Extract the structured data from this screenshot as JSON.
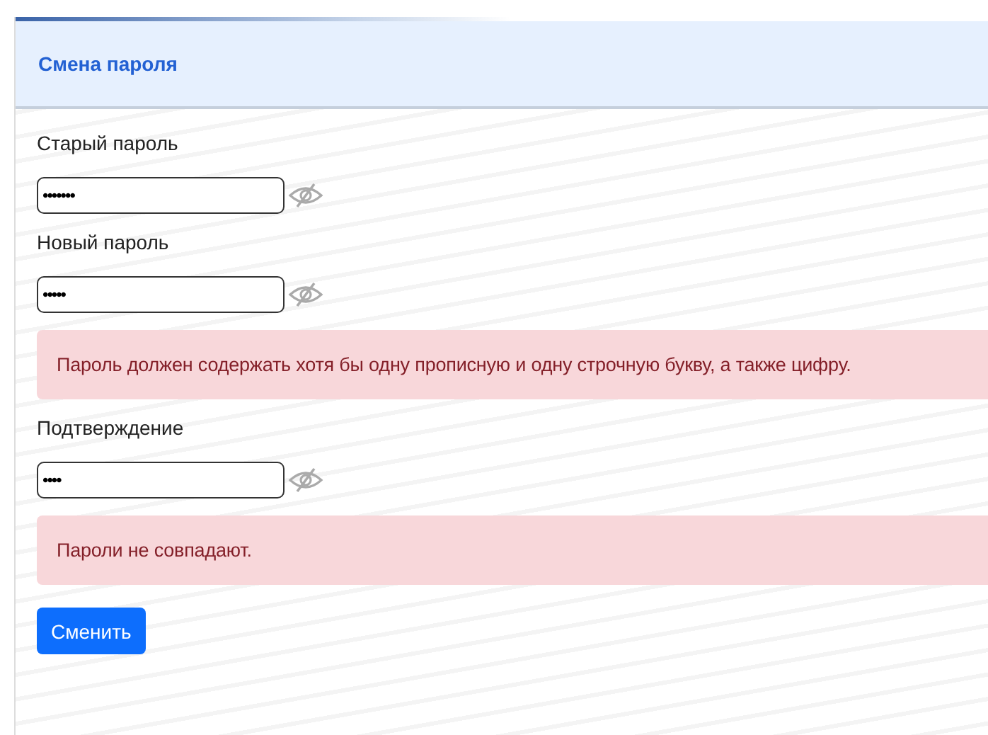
{
  "card": {
    "title": "Смена пароля"
  },
  "form": [
    {
      "kind": "field",
      "label": "Старый пароль",
      "value": "•••••••"
    },
    {
      "kind": "field",
      "label": "Новый пароль",
      "value": "•••••"
    },
    {
      "kind": "alert",
      "text": "Пароль должен содержать хотя бы одну прописную и одну строчную букву, а также цифру."
    },
    {
      "kind": "field",
      "label": "Подтверждение",
      "value": "••••"
    },
    {
      "kind": "alert",
      "text": "Пароли не совпадают."
    }
  ],
  "submit": {
    "label": "Сменить"
  }
}
